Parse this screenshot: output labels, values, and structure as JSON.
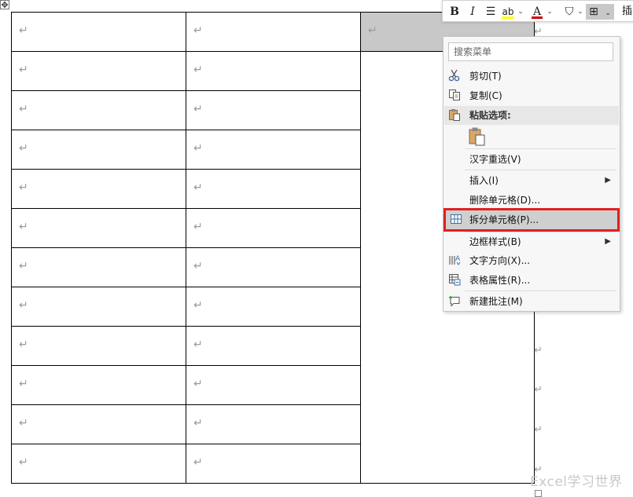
{
  "table": {
    "rows": 12,
    "merged_marks": [
      "↵",
      "↵",
      "↵",
      "↵",
      "↵",
      "↵",
      "↵",
      "↵",
      "↵",
      "↵",
      "↵",
      "↵"
    ],
    "cell_mark": "↵"
  },
  "move_handle_glyph": "✥",
  "toolbar": {
    "bold": "B",
    "italic": "I",
    "align_center": "☰",
    "highlight": "ab",
    "font_color": "A",
    "caret": "⌄",
    "shading": "⛉",
    "border": "⊞",
    "insert": "插入"
  },
  "menu": {
    "search_placeholder": "搜索菜单",
    "items": {
      "cut": "剪切(T)",
      "copy": "复制(C)",
      "paste_options": "粘贴选项:",
      "reconvert": "汉字重选(V)",
      "insert": "插入(I)",
      "delete_cells": "删除单元格(D)...",
      "split_cells": "拆分单元格(P)...",
      "border_styles": "边框样式(B)",
      "text_direction": "文字方向(X)...",
      "table_properties": "表格属性(R)...",
      "new_comment": "新建批注(M)"
    },
    "submenu_arrow": "▶"
  },
  "watermark": "Excel学习世界",
  "colors": {
    "highlight_red": "#e02020",
    "selected_cell": "#c8c8c8",
    "highlighter_yellow": "#ffff00",
    "font_color_red": "#d00000"
  }
}
